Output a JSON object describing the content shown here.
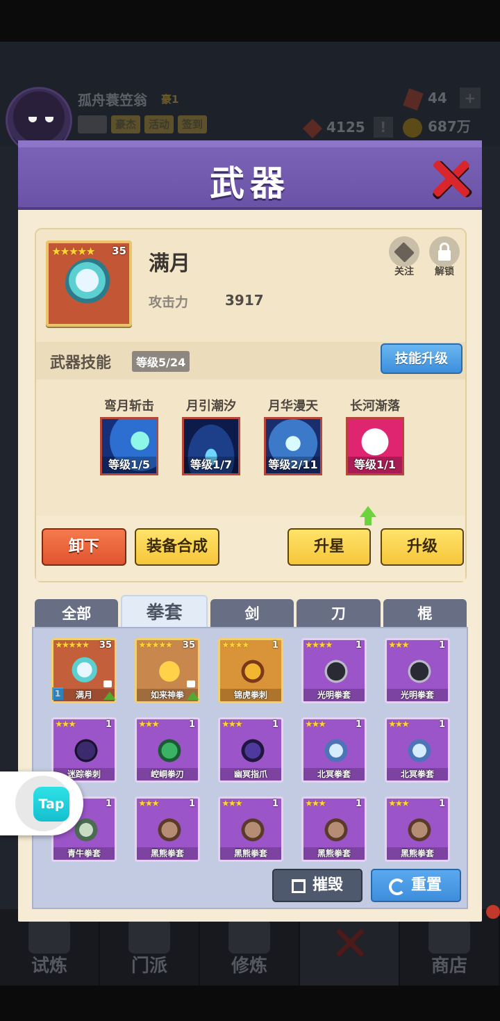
{
  "background": {
    "player": {
      "name": "孤舟蓑笠翁",
      "rank": "豪1"
    },
    "header_buttons": [
      "豪杰",
      "活动",
      "签到"
    ],
    "resources": {
      "gems": "44",
      "tokens": "4125",
      "gold": "687万"
    },
    "nav": [
      "试炼",
      "门派",
      "修炼",
      "",
      "商店"
    ]
  },
  "modal": {
    "title": "武器",
    "weapon": {
      "name": "满月",
      "stars": "★★★★★",
      "level": "35",
      "attack_label": "攻击力",
      "attack_value": "3917"
    },
    "follow_label": "关注",
    "unlock_label": "解锁",
    "skill_section": {
      "title": "武器技能",
      "level": "等级5/24",
      "upgrade_label": "技能升级",
      "skills": [
        {
          "name": "弯月斩击",
          "level": "等级1/5"
        },
        {
          "name": "月引潮汐",
          "level": "等级1/7"
        },
        {
          "name": "月华漫天",
          "level": "等级2/11"
        },
        {
          "name": "长河渐落",
          "level": "等级1/1"
        }
      ]
    },
    "actions": {
      "unequip": "卸下",
      "compose": "装备合成",
      "star_up": "升星",
      "level_up": "升级"
    },
    "tabs": [
      "全部",
      "拳套",
      "剑",
      "刀",
      "棍"
    ],
    "active_tab": "拳套",
    "items": [
      {
        "name": "满月",
        "stars": "★★★★★",
        "level": "35",
        "badge": "1"
      },
      {
        "name": "如来神拳",
        "stars": "★★★★★",
        "level": "35"
      },
      {
        "name": "锦虎拳刺",
        "stars": "★★★★",
        "level": "1"
      },
      {
        "name": "光明拳套",
        "stars": "★★★★",
        "level": "1"
      },
      {
        "name": "光明拳套",
        "stars": "★★★",
        "level": "1"
      },
      {
        "name": "迷踪拳刺",
        "stars": "★★★",
        "level": "1"
      },
      {
        "name": "崆峒拳刃",
        "stars": "★★★",
        "level": "1"
      },
      {
        "name": "幽冥指爪",
        "stars": "★★★",
        "level": "1"
      },
      {
        "name": "北冥拳套",
        "stars": "★★★",
        "level": "1"
      },
      {
        "name": "北冥拳套",
        "stars": "★★★",
        "level": "1"
      },
      {
        "name": "青牛拳套",
        "stars": "★★★",
        "level": "1"
      },
      {
        "name": "黑熊拳套",
        "stars": "★★★",
        "level": "1"
      },
      {
        "name": "黑熊拳套",
        "stars": "★★★",
        "level": "1"
      },
      {
        "name": "黑熊拳套",
        "stars": "★★★",
        "level": "1"
      },
      {
        "name": "黑熊拳套",
        "stars": "★★★",
        "level": "1"
      }
    ],
    "footer": {
      "destroy": "摧毁",
      "reset": "重置"
    }
  },
  "tap_widget": {
    "label": "Tap"
  },
  "colors": {
    "header_purple": "#7d64b8",
    "panel_cream": "#f6ecd6",
    "close_red": "#d9262d",
    "accent_blue": "#3d8fdc"
  }
}
